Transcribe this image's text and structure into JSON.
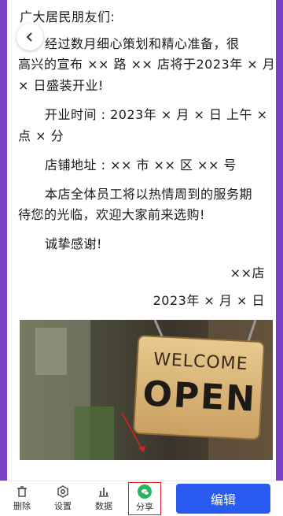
{
  "letter": {
    "greeting": "广大居民朋友们:",
    "p1_line1": "经过数月细心策划和精心准备，很",
    "p1_line2": "高兴的宣布 ×× 路 ×× 店将于2023年 × 月",
    "p1_line3": "× 日盛装开业!",
    "time_line1": "开业时间 : 2023年 × 月 × 日 上午 ×",
    "time_line2": "点 × 分",
    "address": "店铺地址 : ×× 市 ×× 区 ×× 号",
    "p3_line1": "本店全体员工将以热情周到的服务期",
    "p3_line2": "待您的光临，欢迎大家前来选购!",
    "thanks": "诚挚感谢!",
    "signature": "××店",
    "date": "2023年 × 月 × 日"
  },
  "photo": {
    "sign_top": "WELCOME",
    "sign_main": "OPEN"
  },
  "toolbar": {
    "delete_label": "删除",
    "settings_label": "设置",
    "data_label": "数据",
    "share_label": "分享",
    "edit_label": "编辑"
  },
  "colors": {
    "frame": "#7a3fc7",
    "accent": "#2a5bf0",
    "share": "#2bb35b"
  }
}
